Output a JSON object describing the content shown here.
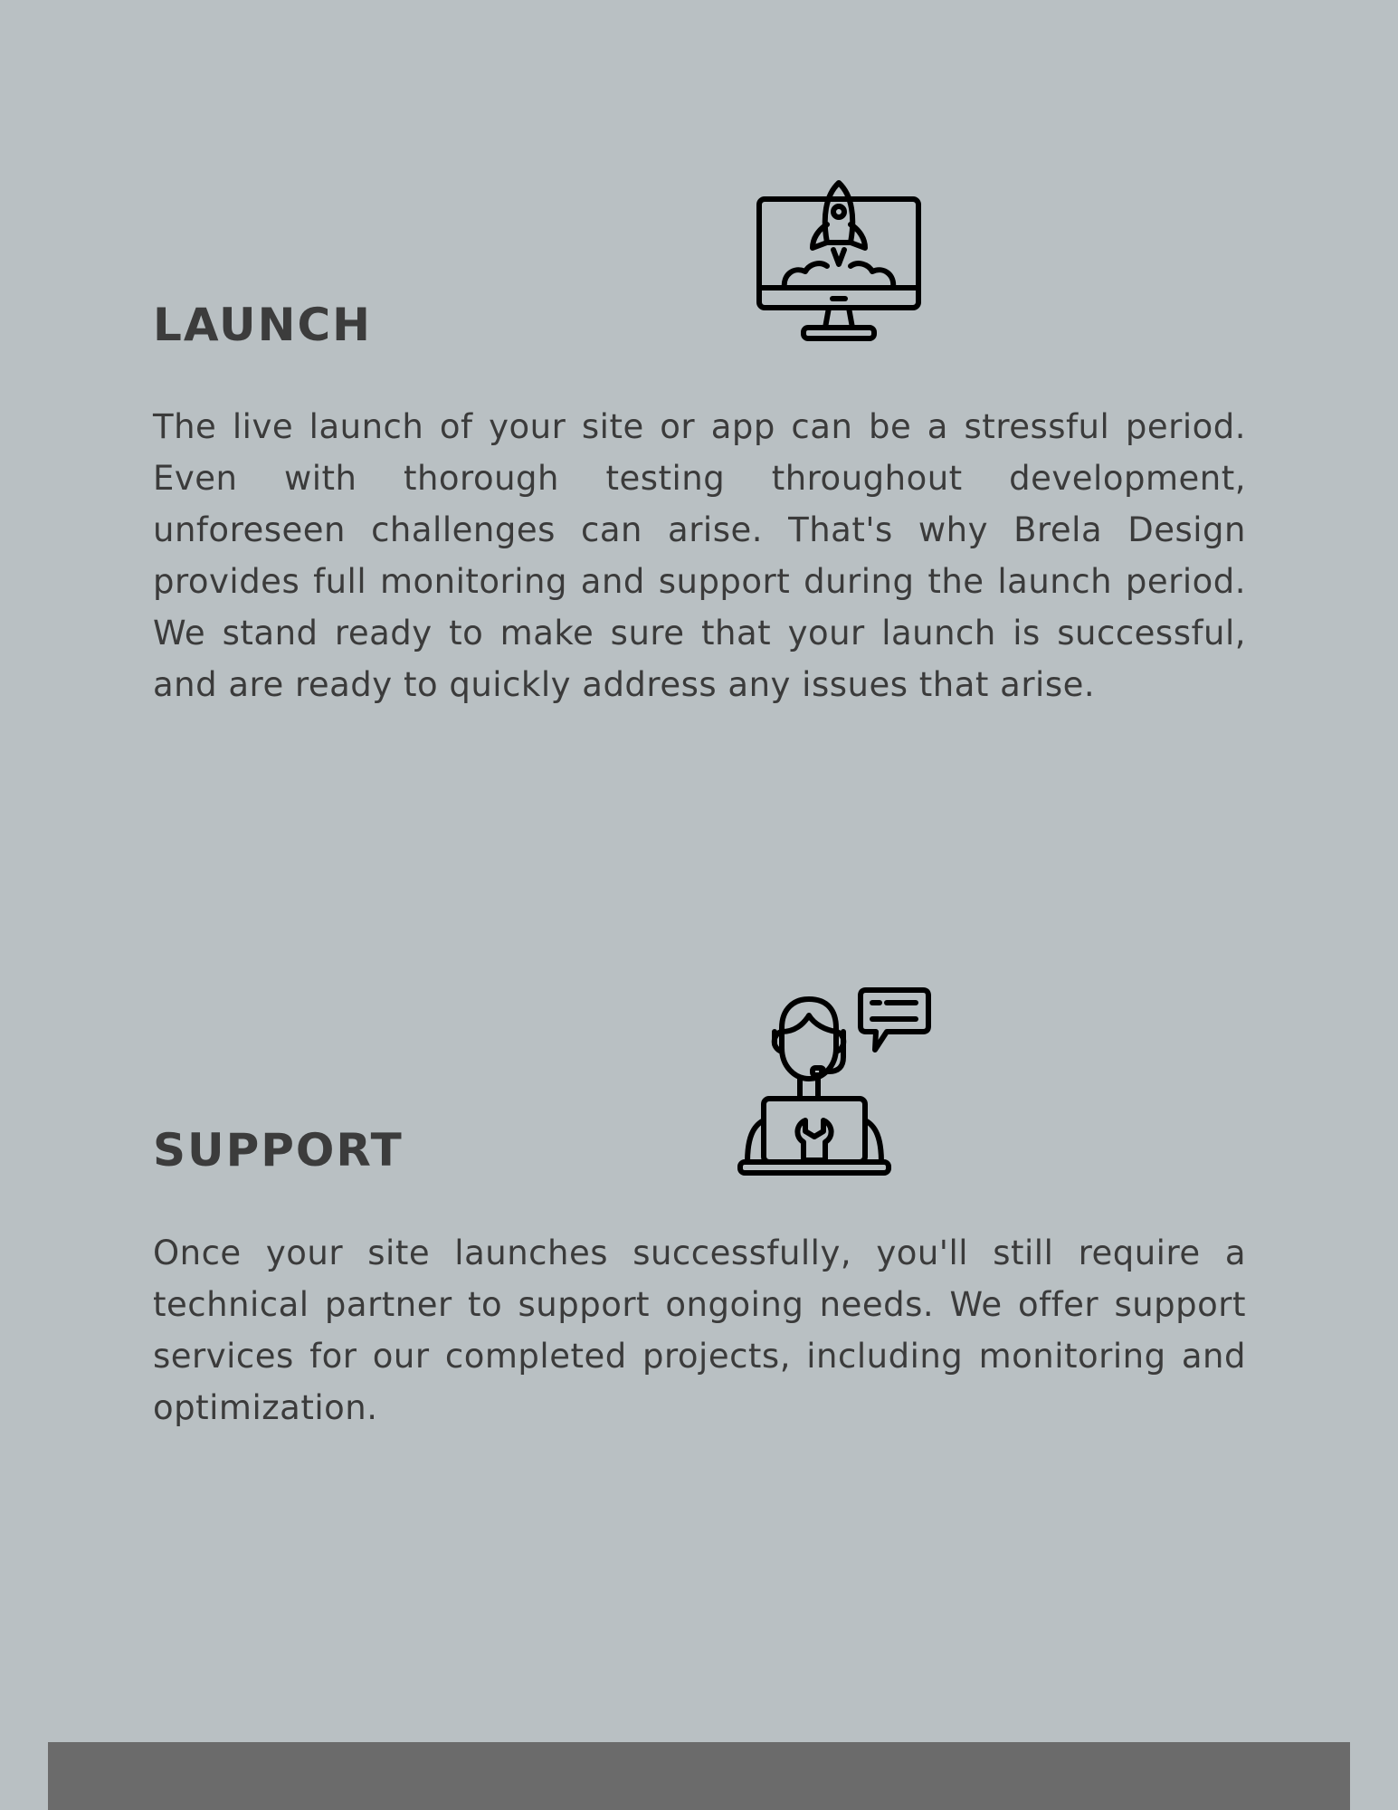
{
  "launch": {
    "title": "LAUNCH",
    "icon": "rocket-monitor-icon",
    "text": "The live launch of your site or app can be a stressful period. Even with thorough testing throughout development, unforeseen challenges can arise. That's why Brela Design provides full monitoring and support during the launch period. We stand ready to make sure that your launch is successful, and are ready to quickly address any issues that arise."
  },
  "support": {
    "title": "SUPPORT",
    "icon": "support-agent-icon",
    "text": "Once your site launches successfully, you'll still require a technical partner to support ongoing needs. We offer support services for our completed projects, including monitoring and optimization."
  },
  "colors": {
    "background": "#b9c0c3",
    "text": "#3b3b3b",
    "footer": "#6b6b6b"
  }
}
